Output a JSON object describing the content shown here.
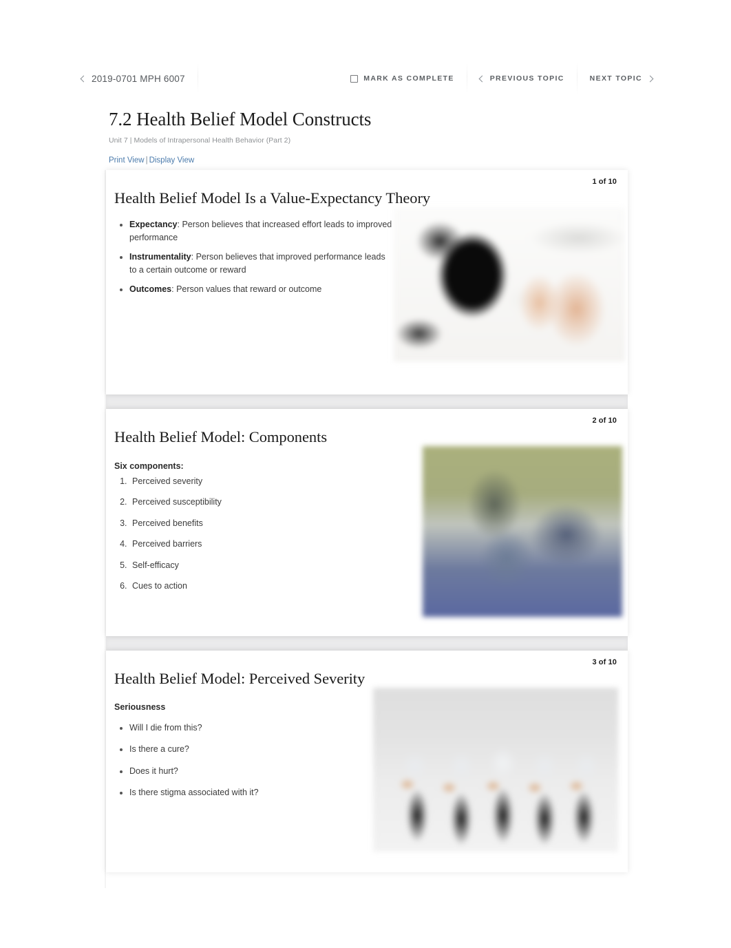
{
  "topnav": {
    "course_back": {
      "icon": "chevron-left-icon",
      "label": "2019-0701 MPH 6007"
    },
    "mark_complete": {
      "icon": "checkbox-empty-icon",
      "label": "MARK AS COMPLETE"
    },
    "previous_topic": {
      "icon": "chevron-left-icon",
      "label": "PREVIOUS TOPIC"
    },
    "next_topic": {
      "icon": "chevron-right-icon",
      "label": "NEXT TOPIC"
    }
  },
  "page": {
    "title": "7.2 Health Belief Model Constructs",
    "subtitle": "Unit 7 | Models of Intrapersonal Health Behavior (Part 2)",
    "view_links": {
      "print": "Print View",
      "separator": "|",
      "display": "Display View"
    }
  },
  "colors": {
    "link": "#4a7aab",
    "heading": "#1a1a1a",
    "body_text": "#3b3b3b",
    "muted": "#8e9194",
    "slide_gap": "#ebebec"
  },
  "slides": [
    {
      "counter": "1 of 10",
      "title": "Health Belief Model Is a Value-Expectancy Theory",
      "list_type": "bullets",
      "items": [
        {
          "term": "Expectancy",
          "sep": ": ",
          "text": "Person believes that increased effort leads to improved performance"
        },
        {
          "term": "Instrumentality",
          "sep": ": ",
          "text": "Person believes that improved performance leads to a certain outcome or reward"
        },
        {
          "term": "Outcomes",
          "sep": ": ",
          "text": "Person values that reward or outcome"
        }
      ],
      "image": "person-holding-blood-pressure-cuff-photo"
    },
    {
      "counter": "2 of 10",
      "title": "Health Belief Model: Components",
      "subhead": "Six components:",
      "list_type": "numbers",
      "items": [
        {
          "text": "Perceived severity"
        },
        {
          "text": "Perceived susceptibility"
        },
        {
          "text": "Perceived benefits"
        },
        {
          "text": "Perceived barriers"
        },
        {
          "text": "Self-efficacy"
        },
        {
          "text": "Cues to action"
        }
      ],
      "image": "person-climbing-rock-photo"
    },
    {
      "counter": "3 of 10",
      "title": "Health Belief Model: Perceived Severity",
      "subhead": "Seriousness",
      "list_type": "bullets",
      "items": [
        {
          "text": "Will I die from this?"
        },
        {
          "text": "Is there a cure?"
        },
        {
          "text": "Does it hurt?"
        },
        {
          "text": "Is there stigma associated with it?"
        }
      ],
      "image": "row-of-people-in-lab-coats-photo"
    }
  ]
}
